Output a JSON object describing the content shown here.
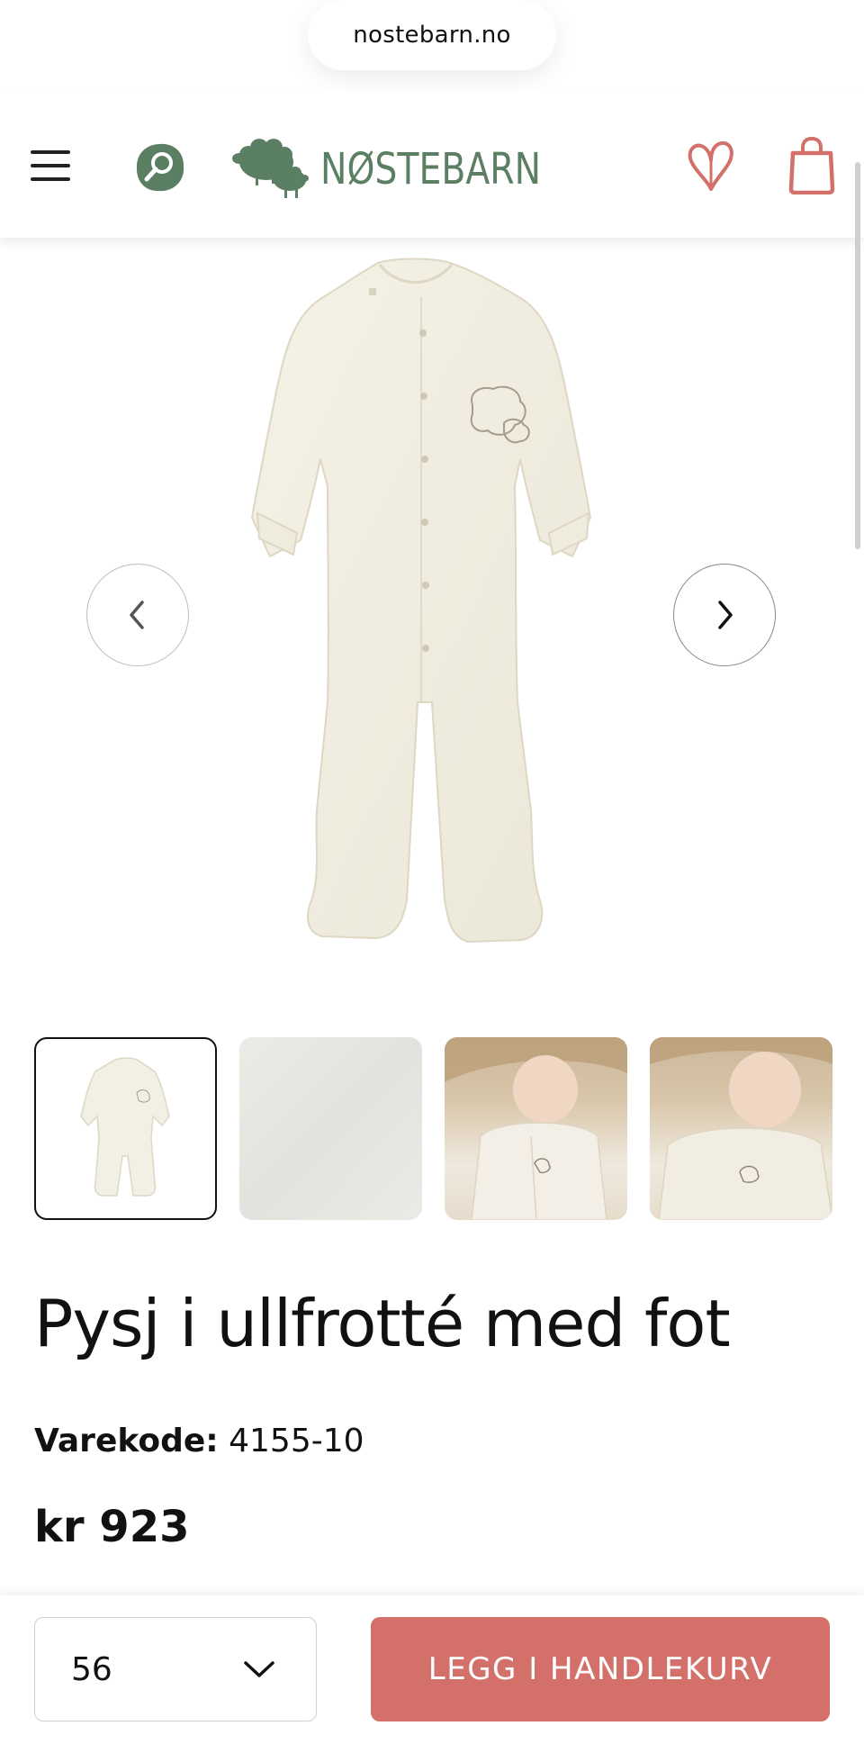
{
  "browser": {
    "url": "nostebarn.no"
  },
  "header": {
    "brand_name": "NØSTEBARN",
    "menu_icon": "hamburger-menu-icon",
    "search_icon": "search-icon",
    "wishlist_icon": "heart-icon",
    "cart_icon": "shopping-bag-icon"
  },
  "colors": {
    "brand_green": "#5b7f62",
    "accent_red": "#d4706a"
  },
  "gallery": {
    "main_image": "white wool footed pajama with sheep embroidery",
    "prev_icon": "chevron-left-icon",
    "next_icon": "chevron-right-icon",
    "thumbnails": [
      {
        "name": "pajama product photo",
        "active": true
      },
      {
        "name": "wool terry fabric close-up",
        "active": false
      },
      {
        "name": "baby wearing pajama in basket",
        "active": false
      },
      {
        "name": "baby wearing pajama close-up",
        "active": false
      }
    ]
  },
  "product": {
    "title": "Pysj i ullfrotté med fot",
    "sku_label": "Varekode:",
    "sku_value": "4155-10",
    "price": "kr 923"
  },
  "purchase": {
    "selected_size": "56",
    "add_to_cart_label": "LEGG I HANDLEKURV"
  }
}
